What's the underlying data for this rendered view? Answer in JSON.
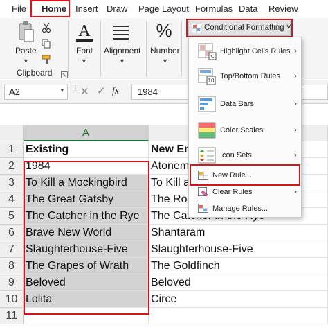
{
  "ribbon_tabs": [
    "File",
    "Home",
    "Insert",
    "Draw",
    "Page Layout",
    "Formulas",
    "Data",
    "Review"
  ],
  "ribbon": {
    "paste_label": "Paste",
    "font_label": "Font",
    "alignment_label": "Alignment",
    "number_label": "Number",
    "clipboard_label": "Clipboard",
    "cf_button_label": "Conditional Formatting ˅"
  },
  "formula_bar": {
    "name_box": "A2",
    "fx": "fx",
    "value": "1984"
  },
  "columns": [
    "A"
  ],
  "rows": [
    "1",
    "2",
    "3",
    "4",
    "5",
    "6",
    "7",
    "8",
    "9",
    "10",
    "11"
  ],
  "cells": {
    "A": [
      "Existing",
      "1984",
      "To Kill a Mockingbird",
      "The Great Gatsby",
      "The Catcher in the Rye",
      "Brave New World",
      "Slaughterhouse-Five",
      "The Grapes of Wrath",
      "Beloved",
      "Lolita"
    ],
    "B": [
      "New En",
      "Atonem",
      "To Kill a",
      "The Roa",
      "The Catcher in the Rye",
      "Shantaram",
      "Slaughterhouse-Five",
      "The Goldfinch",
      "Beloved",
      "Circe"
    ]
  },
  "menu": {
    "items": [
      {
        "label": "Highlight Cells Rules",
        "submenu": true
      },
      {
        "label": "Top/Bottom Rules",
        "submenu": true
      },
      {
        "label": "Data Bars",
        "submenu": true
      },
      {
        "label": "Color Scales",
        "submenu": true
      },
      {
        "label": "Icon Sets",
        "submenu": true
      },
      {
        "label": "New Rule...",
        "submenu": false
      },
      {
        "label": "Clear Rules",
        "submenu": true
      },
      {
        "label": "Manage Rules...",
        "submenu": false
      }
    ],
    "arrow": "›"
  },
  "colors": {
    "highlight_red": "#d9141e",
    "excel_green": "#217346",
    "selection_gray": "#d3d3d3"
  }
}
